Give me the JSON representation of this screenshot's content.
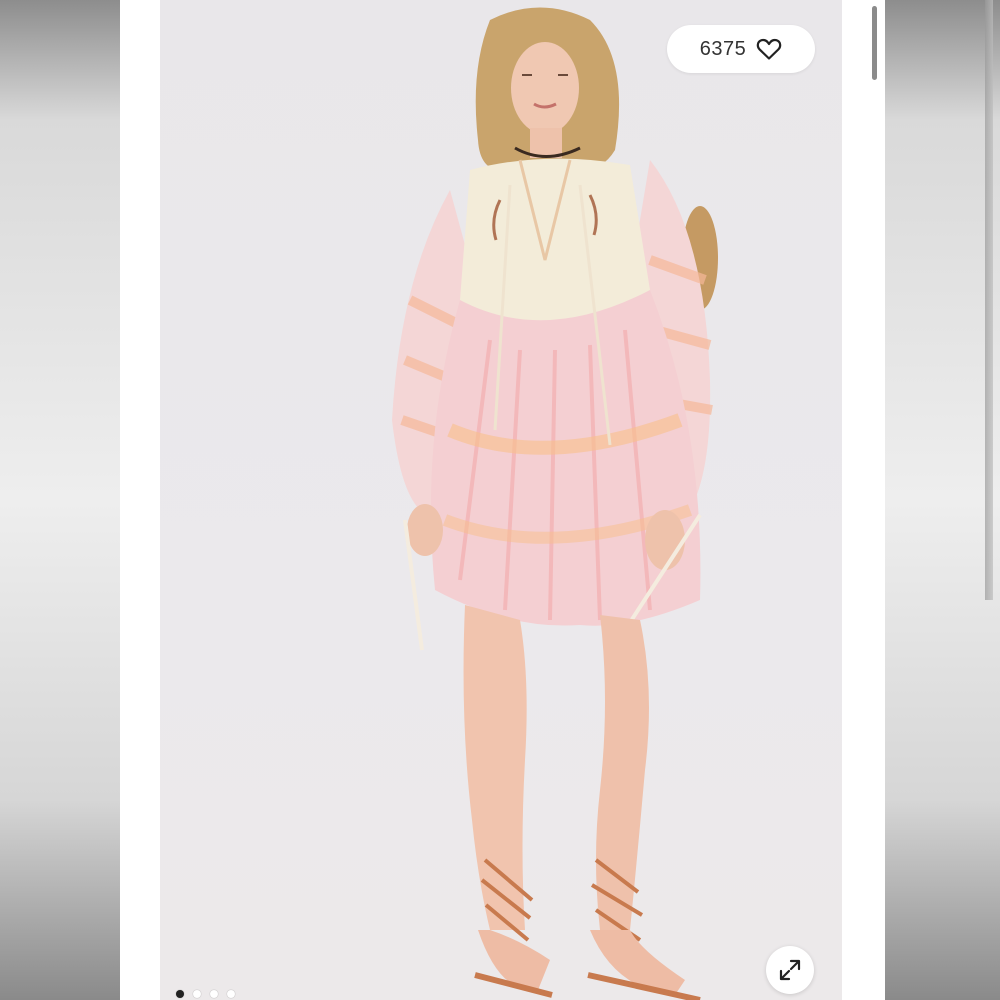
{
  "listing": {
    "likes_count": "6375",
    "like_icon": "heart-icon",
    "expand_icon": "expand-arrows-icon"
  },
  "carousel": {
    "total_images": 4,
    "active_index": 0
  },
  "photo": {
    "description_icon": "product-photo"
  },
  "colors": {
    "background_accent": "#e9e7ea",
    "dress_pink": "#f2b8c0",
    "dress_peach": "#f7c9a0",
    "bodice_cream": "#f3ecd9",
    "sandal_tan": "#c87a4e"
  }
}
